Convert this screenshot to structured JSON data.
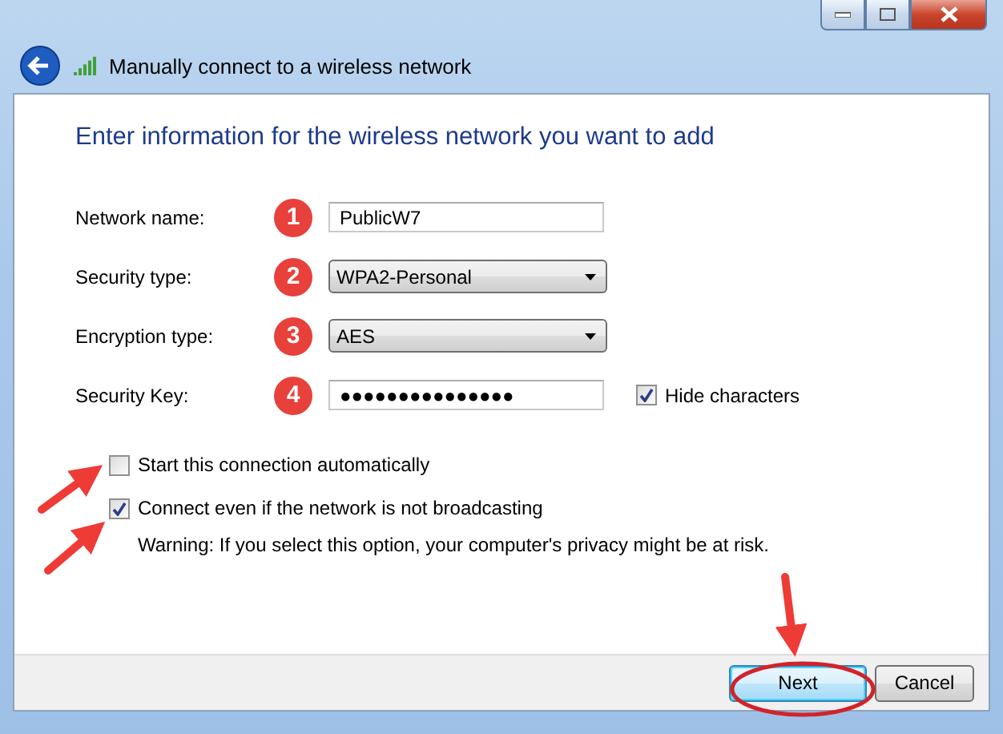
{
  "window": {
    "title": "Manually connect to a wireless network"
  },
  "heading": "Enter information for the wireless network you want to add",
  "fields": [
    {
      "kind": "text",
      "label": "Network name:",
      "step": "1",
      "value": "PublicW7"
    },
    {
      "kind": "dropdown",
      "label": "Security type:",
      "step": "2",
      "value": "WPA2-Personal"
    },
    {
      "kind": "dropdown",
      "label": "Encryption type:",
      "step": "3",
      "value": "AES"
    },
    {
      "kind": "text",
      "label": "Security Key:",
      "step": "4",
      "value": "●●●●●●●●●●●●●●●",
      "option": {
        "label": "Hide characters",
        "checked": true
      }
    }
  ],
  "options": [
    {
      "label": "Start this connection automatically",
      "checked": false
    },
    {
      "label": "Connect even if the network is not broadcasting",
      "checked": true
    }
  ],
  "warning": "Warning: If you select this option, your computer's privacy might be at risk.",
  "buttons": [
    {
      "label": "Next",
      "default": true
    },
    {
      "label": "Cancel",
      "default": false
    }
  ]
}
